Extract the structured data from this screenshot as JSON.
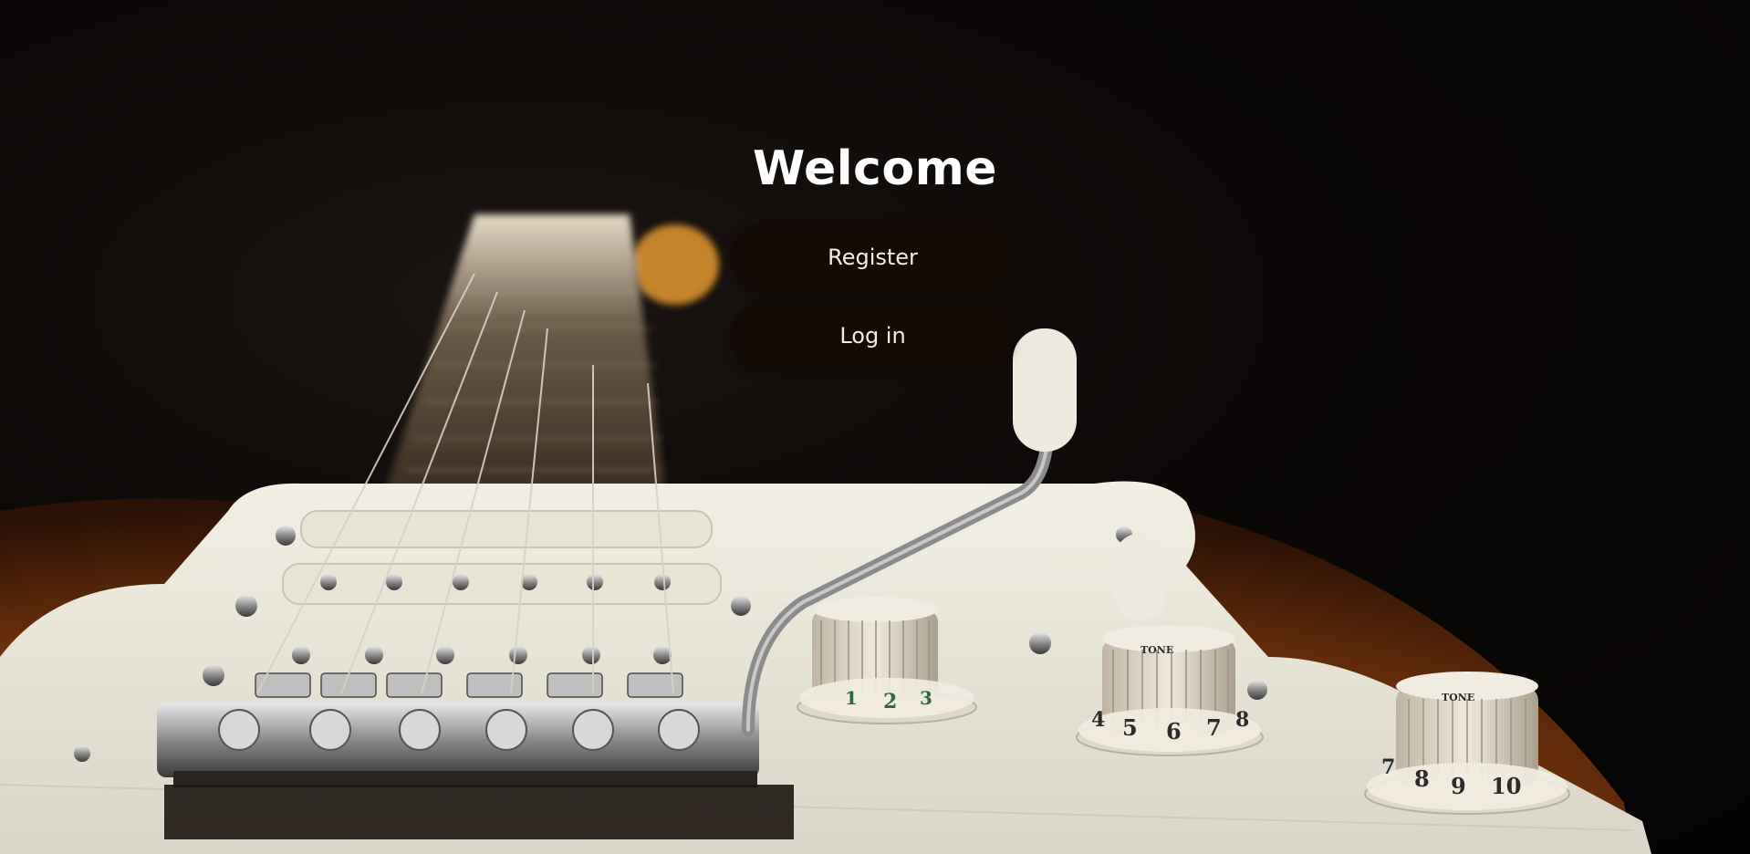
{
  "page": {
    "title": "Welcome"
  },
  "actions": {
    "register_label": "Register",
    "login_label": "Log in"
  },
  "background": {
    "subject": "electric guitar body with pickguard, strings, tremolo arm and control knobs",
    "knob_numbers_a": [
      "1",
      "2",
      "3"
    ],
    "knob_numbers_b": [
      "4",
      "5",
      "6",
      "7",
      "8"
    ],
    "knob_numbers_c": [
      "7",
      "8",
      "9",
      "10"
    ],
    "knob_label_tone": "TONE"
  },
  "colors": {
    "button_bg": "#140b07",
    "button_text": "#f4ece6",
    "title_text": "#ffffff",
    "pickguard": "#ece9de",
    "body_sunburst": "#b8621c"
  }
}
